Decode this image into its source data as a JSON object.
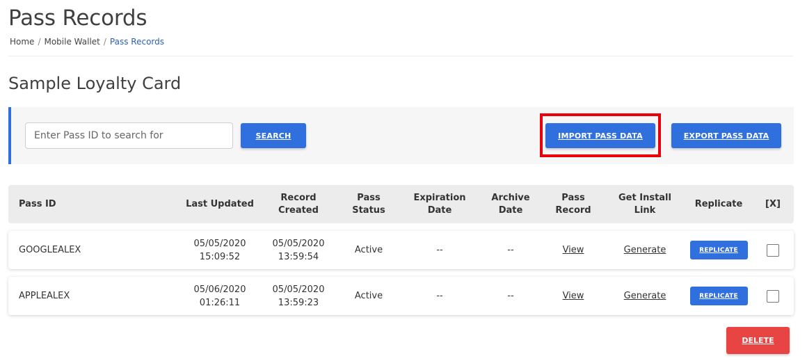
{
  "page": {
    "title": "Pass Records",
    "breadcrumb": [
      "Home",
      "Mobile Wallet",
      "Pass Records"
    ],
    "breadcrumb_sep": "/"
  },
  "section": {
    "title": "Sample Loyalty Card"
  },
  "toolbar": {
    "search_placeholder": "Enter Pass ID to search for",
    "search_label": "SEARCH",
    "import_label": "IMPORT PASS DATA",
    "export_label": "EXPORT PASS DATA"
  },
  "colors": {
    "accent": "#2f6fde",
    "highlight": "#e8000b",
    "danger": "#e84444"
  },
  "table": {
    "columns": [
      "Pass ID",
      "Last Updated",
      "Record Created",
      "Pass Status",
      "Expiration Date",
      "Archive Date",
      "Pass Record",
      "Get Install Link",
      "Replicate",
      "[X]"
    ],
    "rows": [
      {
        "pass_id": "GOOGLEALEX",
        "last_updated_date": "05/05/2020",
        "last_updated_time": "15:09:52",
        "created_date": "05/05/2020",
        "created_time": "13:59:54",
        "status": "Active",
        "expiration": "--",
        "archive": "--",
        "record": "View",
        "install": "Generate",
        "replicate": "REPLICATE"
      },
      {
        "pass_id": "APPLEALEX",
        "last_updated_date": "05/06/2020",
        "last_updated_time": "01:26:11",
        "created_date": "05/05/2020",
        "created_time": "13:59:23",
        "status": "Active",
        "expiration": "--",
        "archive": "--",
        "record": "View",
        "install": "Generate",
        "replicate": "REPLICATE"
      }
    ]
  },
  "actions": {
    "delete_label": "DELETE"
  }
}
